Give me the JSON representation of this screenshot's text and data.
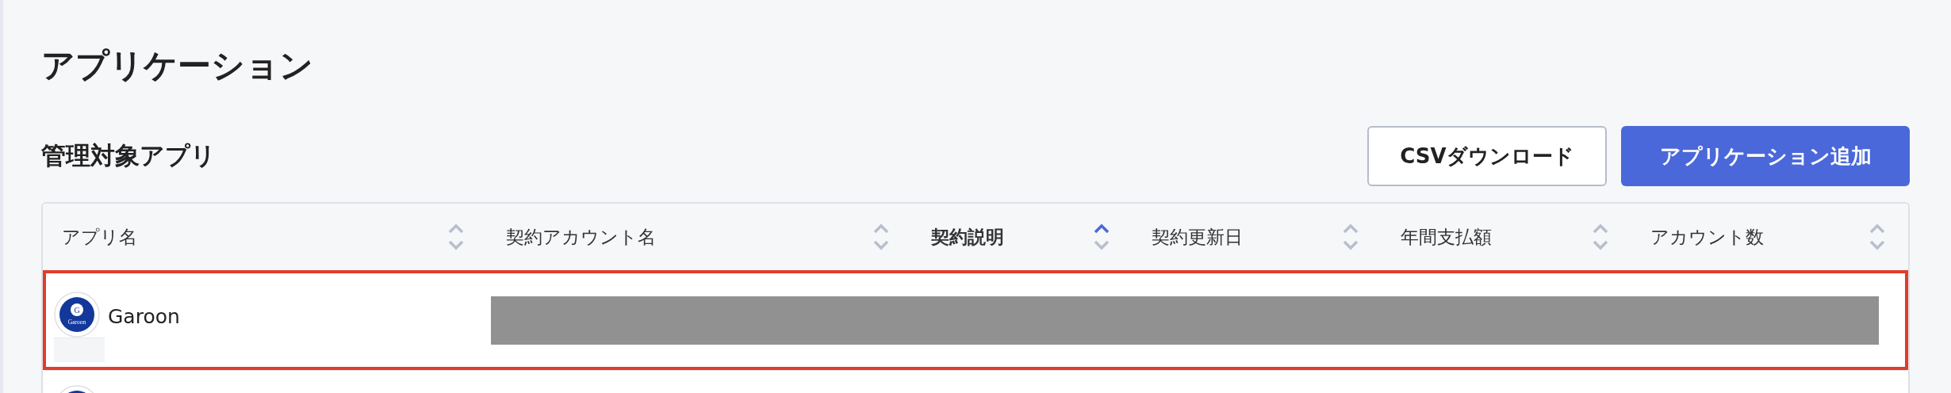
{
  "page_title": "アプリケーション",
  "section_title": "管理対象アプリ",
  "buttons": [
    {
      "label": "CSVダウンロード",
      "kind": "secondary"
    },
    {
      "label": "アプリケーション追加",
      "kind": "primary"
    }
  ],
  "table": {
    "columns": [
      {
        "label": "アプリ名",
        "sorted": false
      },
      {
        "label": "契約アカウント名",
        "sorted": false
      },
      {
        "label": "契約説明",
        "sorted": true
      },
      {
        "label": "契約更新日",
        "sorted": false
      },
      {
        "label": "年間支払額",
        "sorted": false
      },
      {
        "label": "アカウント数",
        "sorted": false
      }
    ],
    "rows": [
      {
        "name": "Garoon",
        "logo": {
          "letter": "G",
          "text": "Garoon"
        },
        "highlighted": true,
        "redacted": true
      },
      {
        "highlighted": false,
        "logo": {}
      }
    ]
  }
}
